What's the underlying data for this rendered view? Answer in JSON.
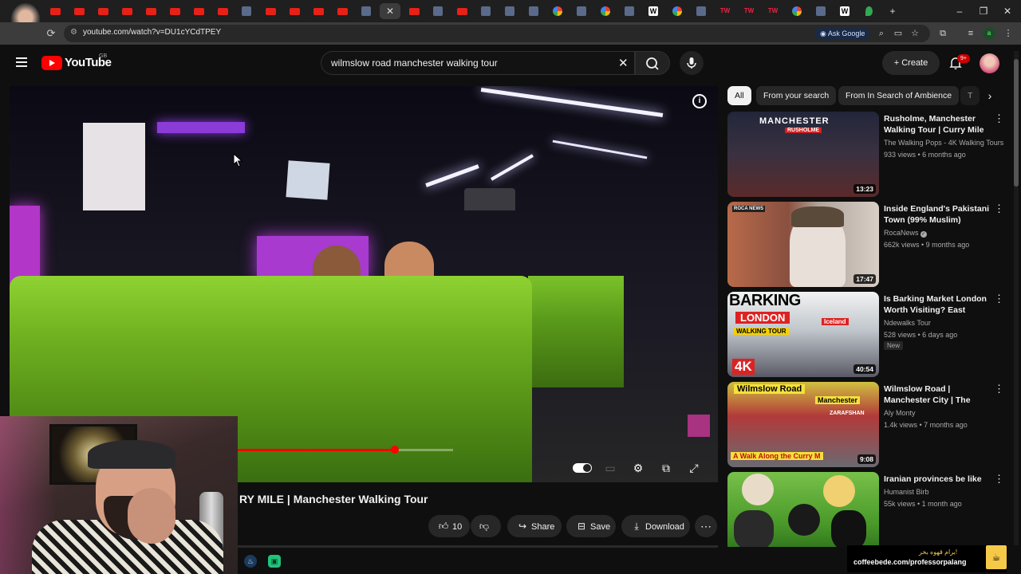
{
  "browser": {
    "url": "youtube.com/watch?v=DU1cYCdTPEY",
    "ask_google": "Ask Google",
    "tab_close": "✕",
    "new_tab": "+",
    "tab_favicons": [
      "youtube",
      "youtube",
      "youtube",
      "youtube",
      "youtube",
      "youtube",
      "youtube",
      "youtube",
      "other",
      "youtube",
      "youtube",
      "youtube",
      "youtube",
      "other",
      "active-youtube",
      "youtube",
      "other",
      "youtube",
      "other",
      "other",
      "other",
      "google",
      "other",
      "google",
      "other",
      "wikipedia",
      "google",
      "other",
      "tweakers",
      "tweakers",
      "tweakers",
      "google",
      "other",
      "wikipedia",
      "maps"
    ],
    "tweakers_label": "TW",
    "wiki_label": "W"
  },
  "youtube": {
    "wordmark": "YouTube",
    "region": "GB",
    "search_query": "wilmslow road manchester walking tour",
    "create_label": "Create",
    "notification_count": "9+"
  },
  "player": {
    "progress_fraction": 0.73,
    "title": "RY MILE | Manchester Walking Tour"
  },
  "actions": {
    "likes": "10",
    "share": "Share",
    "save": "Save",
    "download": "Download"
  },
  "sidebar": {
    "chips": [
      "All",
      "From your search",
      "From In Search of Ambience",
      "T"
    ],
    "recommendations": [
      {
        "title": "Rusholme, Manchester Walking Tour | Curry Mile ...",
        "channel": "The Walking Pops - 4K Walking Tours",
        "meta": "933 views • 6 months ago",
        "duration": "13:23",
        "thumb_text": [
          "MANCHESTER",
          "RUSHOLME"
        ],
        "verified": false,
        "badge": ""
      },
      {
        "title": "Inside England's Pakistani Town (99% Muslim)",
        "channel": "RocaNews",
        "meta": "662k views • 9 months ago",
        "duration": "17:47",
        "thumb_text": [
          "ROCA NEWS"
        ],
        "verified": true,
        "badge": ""
      },
      {
        "title": "Is Barking Market London Worth Visiting? East Londo...",
        "channel": "Ndewalks Tour",
        "meta": "528 views • 6 days ago",
        "duration": "40:54",
        "thumb_text": [
          "BARKING",
          "LONDON",
          "WALKING TOUR",
          "4K",
          "Iceland"
        ],
        "verified": false,
        "badge": "New"
      },
      {
        "title": "Wilmslow Road | Manchester City | The Curr...",
        "channel": "Aly Monty",
        "meta": "1.4k views • 7 months ago",
        "duration": "9:08",
        "thumb_text": [
          "Wilmslow Road",
          "Manchester",
          "ZARAFSHAN",
          "A Walk Along the Curry M"
        ],
        "verified": false,
        "badge": ""
      },
      {
        "title": "Iranian provinces be like",
        "channel": "Humanist Birb",
        "meta": "55k views • 1 month ago",
        "duration": "",
        "thumb_text": [],
        "verified": false,
        "badge": ""
      }
    ]
  },
  "overlay": {
    "coffee_line1": "برام قهوه بخر!",
    "coffee_line2": "coffeebede.com/professorpalang"
  },
  "colors": {
    "accent": "#ff0000",
    "background": "#0f0f0f",
    "chip": "#272727"
  }
}
